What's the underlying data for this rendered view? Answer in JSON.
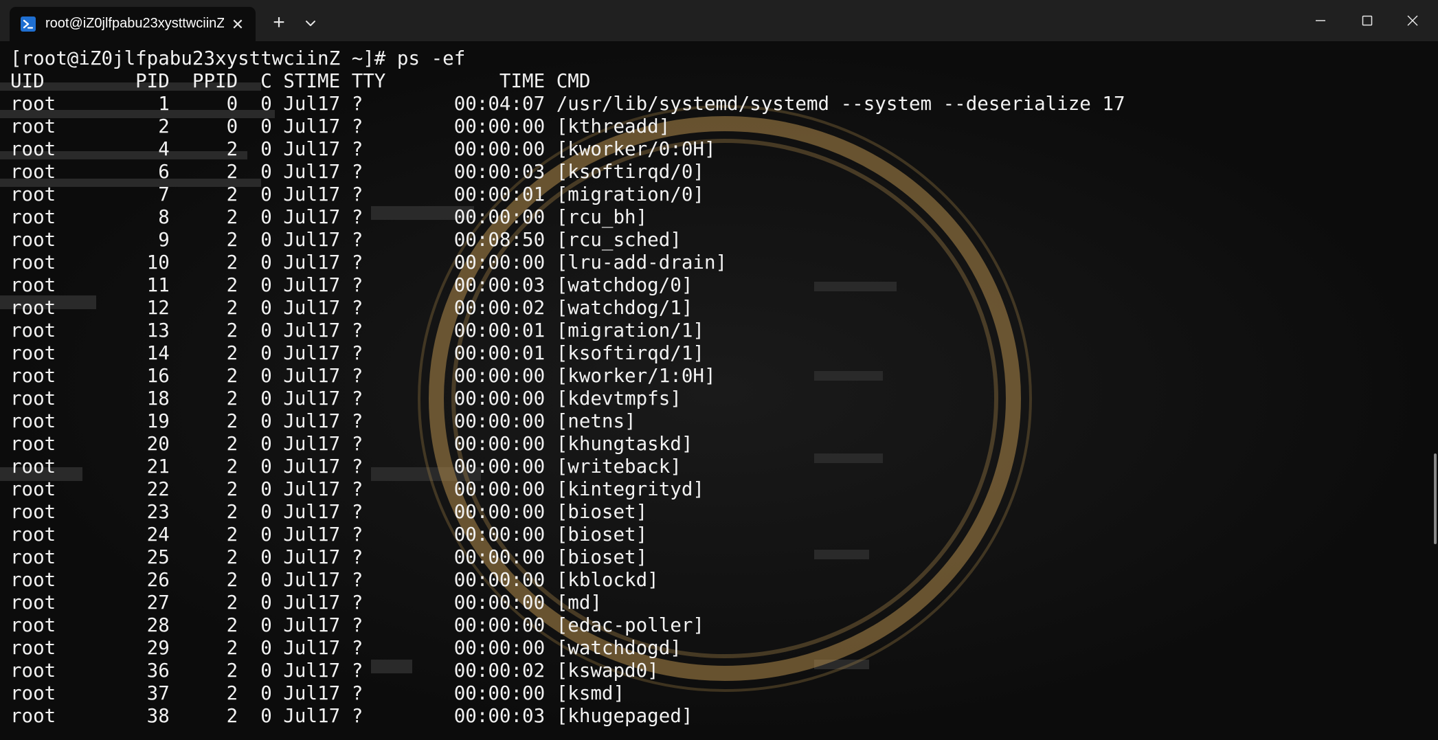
{
  "window": {
    "tab_title": "root@iZ0jlfpabu23xysttwciinZ",
    "tab_icon": "powershell-icon",
    "new_tab_label": "+",
    "close_tab_label": "✕"
  },
  "colors": {
    "titlebar": "#202020",
    "terminal_bg": "#0c0c0c",
    "text": "#f2f2f2",
    "art": "#b08a4a"
  },
  "terminal": {
    "lines": [
      "[root@iZ0jlfpabu23xysttwciinZ ~]# ps -ef",
      "UID        PID  PPID  C STIME TTY          TIME CMD",
      "root         1     0  0 Jul17 ?        00:04:07 /usr/lib/systemd/systemd --system --deserialize 17",
      "root         2     0  0 Jul17 ?        00:00:00 [kthreadd]",
      "root         4     2  0 Jul17 ?        00:00:00 [kworker/0:0H]",
      "root         6     2  0 Jul17 ?        00:00:03 [ksoftirqd/0]",
      "root         7     2  0 Jul17 ?        00:00:01 [migration/0]",
      "root         8     2  0 Jul17 ?        00:00:00 [rcu_bh]",
      "root         9     2  0 Jul17 ?        00:08:50 [rcu_sched]",
      "root        10     2  0 Jul17 ?        00:00:00 [lru-add-drain]",
      "root        11     2  0 Jul17 ?        00:00:03 [watchdog/0]",
      "root        12     2  0 Jul17 ?        00:00:02 [watchdog/1]",
      "root        13     2  0 Jul17 ?        00:00:01 [migration/1]",
      "root        14     2  0 Jul17 ?        00:00:01 [ksoftirqd/1]",
      "root        16     2  0 Jul17 ?        00:00:00 [kworker/1:0H]",
      "root        18     2  0 Jul17 ?        00:00:00 [kdevtmpfs]",
      "root        19     2  0 Jul17 ?        00:00:00 [netns]",
      "root        20     2  0 Jul17 ?        00:00:00 [khungtaskd]",
      "root        21     2  0 Jul17 ?        00:00:00 [writeback]",
      "root        22     2  0 Jul17 ?        00:00:00 [kintegrityd]",
      "root        23     2  0 Jul17 ?        00:00:00 [bioset]",
      "root        24     2  0 Jul17 ?        00:00:00 [bioset]",
      "root        25     2  0 Jul17 ?        00:00:00 [bioset]",
      "root        26     2  0 Jul17 ?        00:00:00 [kblockd]",
      "root        27     2  0 Jul17 ?        00:00:00 [md]",
      "root        28     2  0 Jul17 ?        00:00:00 [edac-poller]",
      "root        29     2  0 Jul17 ?        00:00:00 [watchdogd]",
      "root        36     2  0 Jul17 ?        00:00:02 [kswapd0]",
      "root        37     2  0 Jul17 ?        00:00:00 [ksmd]",
      "root        38     2  0 Jul17 ?        00:00:03 [khugepaged]"
    ]
  }
}
